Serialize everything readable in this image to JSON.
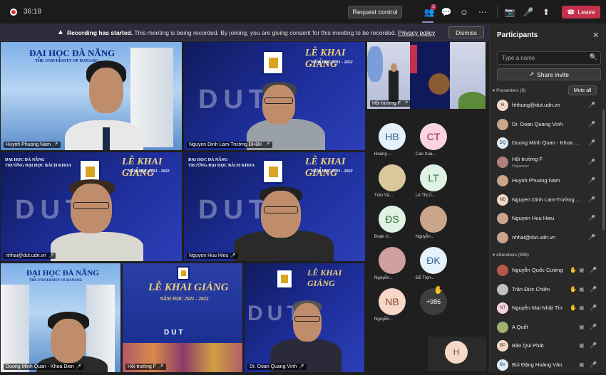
{
  "topbar": {
    "timer": "36:18",
    "request_control": "Request control",
    "people_badge": "2",
    "leave": "Leave"
  },
  "banner": {
    "title": "Recording has started.",
    "message": "This meeting is being recorded. By joining, you are giving consent for this meeting to be recorded.",
    "link": "Privacy policy",
    "dismiss": "Dismiss"
  },
  "tiles": {
    "t1": "Huynh Phuong Nam",
    "t2": "Nguyen Dinh Lam-Trường ĐHBK",
    "t3": "nhhai@dut.udn.vn",
    "t4": "Nguyen Huu Hieu",
    "t5": "Duong Minh Quan - Khoa Dien",
    "t6": "Hội trường F",
    "t7": "Dr. Doan Quang Vinh",
    "spotlight": "Hội trường F"
  },
  "signage": {
    "dhdn": "ĐẠI HỌC ĐÀ NẴNG",
    "udn": "THE UNIVERSITY OF DANANG",
    "khai_giang": "LỄ KHAI GIẢNG",
    "nam_hoc": "NĂM HỌC 2021 - 2022",
    "dut": "DUT",
    "bk_small": "ĐẠI HỌC ĐÀ NẴNG",
    "bk_name": "TRƯỜNG ĐẠI HỌC BÁCH KHOA"
  },
  "avatars": [
    {
      "initials": "HB",
      "label": "Hoàng ...",
      "color": "#e6f2fb",
      "text": "#2a5f8f"
    },
    {
      "initials": "CT",
      "label": "Cao Xua...",
      "color": "#f9d4de",
      "text": "#8a2b45"
    },
    {
      "initials": "",
      "label": "Trần Vă...",
      "color": "#d9c89a",
      "text": "#333"
    },
    {
      "initials": "LT",
      "label": "Lê Thị Ù...",
      "color": "#dff3e4",
      "text": "#2b6e3a"
    },
    {
      "initials": "ĐS",
      "label": "Đoàn V...",
      "color": "#dff3e4",
      "text": "#2b6e3a"
    },
    {
      "initials": "",
      "label": "Nguyễn...",
      "color": "#c9a58b",
      "text": "#333"
    },
    {
      "initials": "",
      "label": "Nguyễn...",
      "color": "#d0a0a0",
      "text": "#333"
    },
    {
      "initials": "ĐK",
      "label": "Đỗ Trọn...",
      "color": "#e6f2fb",
      "text": "#2a5f8f"
    },
    {
      "initials": "NB",
      "label": "Nguyễn...",
      "color": "#f7d8c8",
      "text": "#8a4428"
    },
    {
      "initials": "+986",
      "label": "",
      "color": "#3d3d3d",
      "text": "#fff"
    }
  ],
  "self_initial": "H",
  "panel": {
    "title": "Participants",
    "search_placeholder": "Type a name",
    "share_invite": "Share invite",
    "presenters_header": "Presenters (8)",
    "mute_all": "Mute all",
    "attendees_header": "Attendees (995)",
    "presenters": [
      {
        "name": "hhhung@dut.udn.vn",
        "initials": "H",
        "sub": "",
        "color": "#f3d9c7"
      },
      {
        "name": "Dr. Doan Quang Vinh",
        "initials": "",
        "sub": "",
        "color": "#c9a58b"
      },
      {
        "name": "Duong Minh Quan - Khoa Dien",
        "initials": "DQ",
        "sub": "",
        "color": "#dcecf8"
      },
      {
        "name": "Hội trường F",
        "initials": "",
        "sub": "Organizer",
        "color": "#b08080"
      },
      {
        "name": "Huynh Phuong Nam",
        "initials": "",
        "sub": "",
        "color": "#c9a58b"
      },
      {
        "name": "Nguyen Dinh Lam-Trường Đ...",
        "initials": "NĐ",
        "sub": "",
        "color": "#f3d9c7"
      },
      {
        "name": "Nguyen Huu Hieu",
        "initials": "",
        "sub": "",
        "color": "#c9a58b"
      },
      {
        "name": "nhhai@dut.udn.vn",
        "initials": "",
        "sub": "",
        "color": "#c9a58b"
      }
    ],
    "attendees": [
      {
        "name": "Nguyễn Quốc Cường",
        "initials": "",
        "color": "#b55a4a",
        "hand": true
      },
      {
        "name": "Trần Đức Chiến",
        "initials": "",
        "color": "#c0c0c0",
        "hand": true
      },
      {
        "name": "Nguyễn Mai Nhật Tín",
        "initials": "NT",
        "color": "#f9d4de",
        "hand": true
      },
      {
        "name": "A Quết",
        "initials": "",
        "color": "#a0b070",
        "hand": false
      },
      {
        "name": "Bảo Qui Phát",
        "initials": "BP",
        "color": "#f7d8c8",
        "hand": false
      },
      {
        "name": "Bùi Đặng Hoàng Vân",
        "initials": "BV",
        "color": "#dcecf8",
        "hand": false
      }
    ]
  }
}
